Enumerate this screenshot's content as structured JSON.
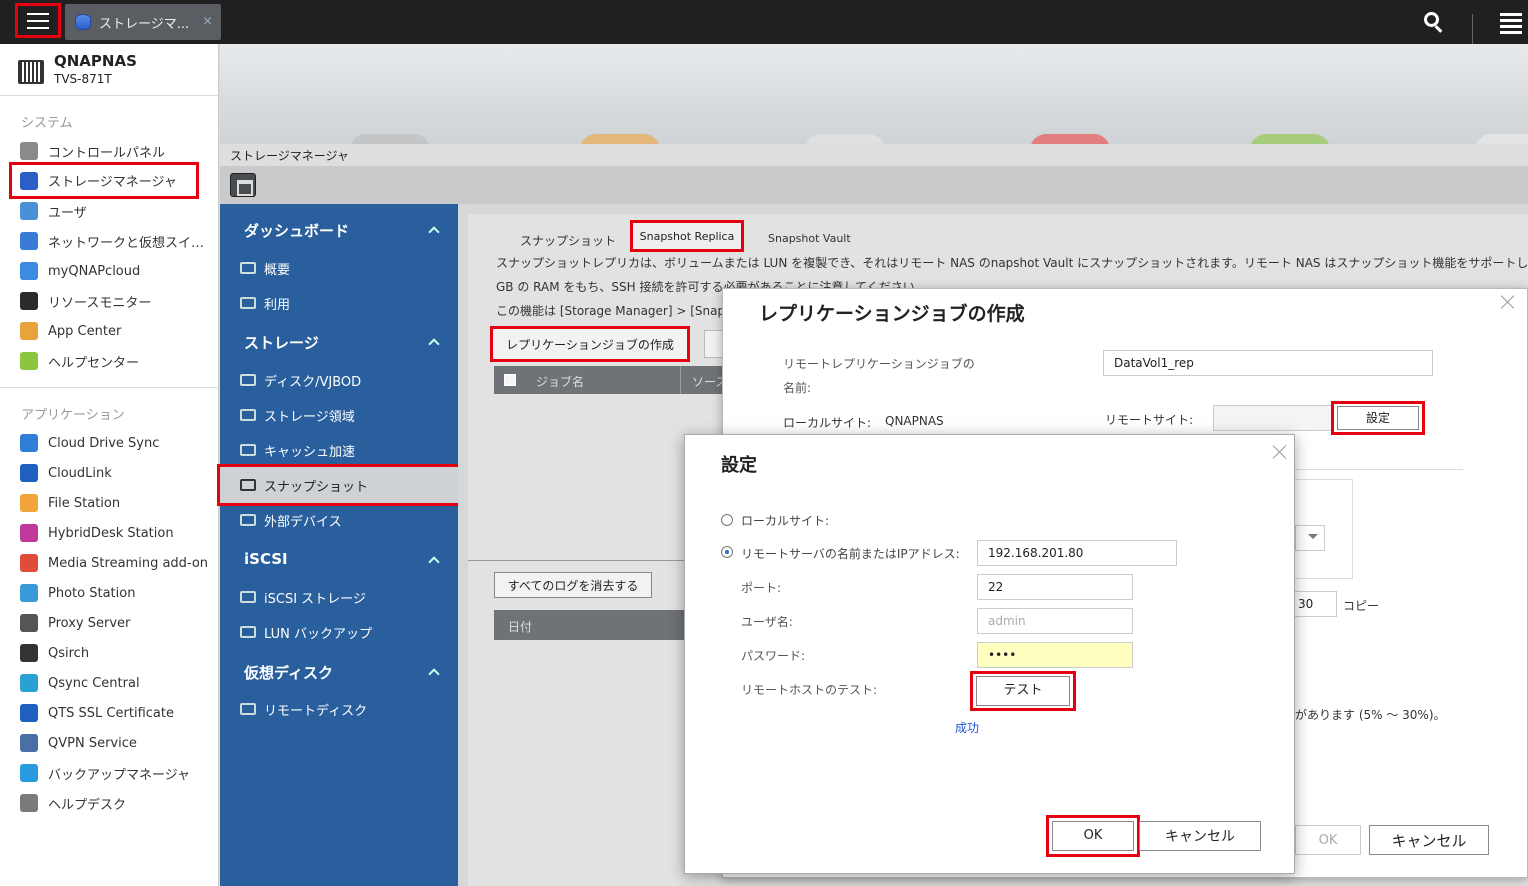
{
  "topbar": {
    "tab_title": "ストレージマ...",
    "tab_close": "×"
  },
  "sidebar": {
    "device_name": "QNAPNAS",
    "device_model": "TVS-871T",
    "system_section": "システム",
    "system_items": [
      {
        "label": "コントロールパネル",
        "icon": "gear-icon",
        "color": "#8a8a8a"
      },
      {
        "label": "ストレージマネージャ",
        "icon": "database-icon",
        "color": "#2b5fc7"
      },
      {
        "label": "ユーザ",
        "icon": "user-icon",
        "color": "#4a90d9"
      },
      {
        "label": "ネットワークと仮想スイ…",
        "icon": "network-icon",
        "color": "#3a7bd5"
      },
      {
        "label": "myQNAPcloud",
        "icon": "cloud-icon",
        "color": "#3b8be0"
      },
      {
        "label": "リソースモニター",
        "icon": "monitor-icon",
        "color": "#2b2b2b"
      },
      {
        "label": "App Center",
        "icon": "grid-icon",
        "color": "#e8a33c"
      },
      {
        "label": "ヘルプセンター",
        "icon": "help-icon",
        "color": "#8cc63f"
      }
    ],
    "apps_section": "アプリケーション",
    "app_items": [
      {
        "label": "Cloud Drive Sync",
        "icon": "cloud-sync-icon",
        "color": "#2f7fd8"
      },
      {
        "label": "CloudLink",
        "icon": "cloudlink-icon",
        "color": "#1f5fbf"
      },
      {
        "label": "File Station",
        "icon": "folder-icon",
        "color": "#f2a33a"
      },
      {
        "label": "HybridDesk Station",
        "icon": "hd-icon",
        "color": "#c0399b"
      },
      {
        "label": "Media Streaming add-on",
        "icon": "media-icon",
        "color": "#e04b3a"
      },
      {
        "label": "Photo Station",
        "icon": "photo-icon",
        "color": "#3a9ad9"
      },
      {
        "label": "Proxy Server",
        "icon": "proxy-icon",
        "color": "#555555"
      },
      {
        "label": "Qsirch",
        "icon": "qsirch-icon",
        "color": "#333333"
      },
      {
        "label": "Qsync Central",
        "icon": "qsync-icon",
        "color": "#2aa1d3"
      },
      {
        "label": "QTS SSL Certificate",
        "icon": "certificate-icon",
        "color": "#1f5fbf"
      },
      {
        "label": "QVPN Service",
        "icon": "vpn-icon",
        "color": "#4a6fa5"
      },
      {
        "label": "バックアップマネージャ",
        "icon": "backup-icon",
        "color": "#2b9be0"
      },
      {
        "label": "ヘルプデスク",
        "icon": "helpdesk-icon",
        "color": "#7a7a7a"
      }
    ]
  },
  "window": {
    "title": "ストレージマネージャ"
  },
  "nav": {
    "dashboard": "ダッシュボード",
    "overview": "概要",
    "usage": "利用",
    "storage": "ストレージ",
    "disks": "ディスク/VJBOD",
    "storage_space": "ストレージ領域",
    "cache": "キャッシュ加速",
    "snapshot": "スナップショット",
    "external": "外部デバイス",
    "iscsi": "iSCSI",
    "iscsi_storage": "iSCSI ストレージ",
    "lun_backup": "LUN バックアップ",
    "virtual_disk": "仮想ディスク",
    "remote_disk": "リモートディスク"
  },
  "content": {
    "tab_snapshot": "スナップショット",
    "tab_replica": "Snapshot Replica",
    "tab_vault": "Snapshot Vault",
    "desc_line1": "スナップショットレプリカは、ボリュームまたは LUN を複製でき、それはリモート NAS のnapshot Vault にスナップショットされます。リモート NAS はスナップショット機能をサポートし、",
    "desc_line2": "GB の RAM をもち、SSH 接続を許可する必要があることに注意してください。",
    "desc_line3": "この機能は [Storage Manager] > [Snapshot",
    "create_job": "レプリケーションジョブの作成",
    "col_job_name": "ジョブ名",
    "col_source": "ソース",
    "clear_logs": "すべてのログを消去する",
    "col_date": "日付"
  },
  "dialog1": {
    "title": "レプリケーションジョブの作成",
    "job_name_label_1": "リモートレプリケーションジョブの",
    "job_name_label_2": "名前:",
    "job_name_value": "DataVol1_rep",
    "local_site_label": "ローカルサイト:",
    "local_site_value": "QNAPNAS",
    "remote_site_label": "リモートサイト:",
    "settings": "設定",
    "copies_value": "30",
    "copies_label": "コピー",
    "percent_note": "があります (5% ～ 30%)。",
    "ok": "OK",
    "cancel": "キャンセル"
  },
  "dialog2": {
    "title": "設定",
    "local_site": "ローカルサイト:",
    "remote_server": "リモートサーバの名前またはIPアドレス:",
    "remote_server_value": "192.168.201.80",
    "port_label": "ポート:",
    "port_value": "22",
    "username_label": "ユーザ名:",
    "username_placeholder": "admin",
    "password_label": "パスワード:",
    "password_value": "••••",
    "test_label": "リモートホストのテスト:",
    "test_button": "テスト",
    "success": "成功",
    "ok": "OK",
    "cancel": "キャンセル"
  }
}
